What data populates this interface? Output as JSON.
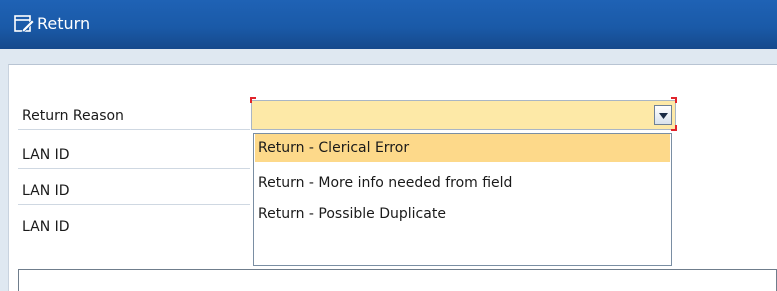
{
  "window": {
    "title": "Return",
    "title_icon": "edit-window-icon"
  },
  "form": {
    "fields": [
      {
        "label": "Return Reason"
      },
      {
        "label": "LAN ID"
      },
      {
        "label": "LAN ID"
      },
      {
        "label": "LAN ID"
      }
    ],
    "return_reason": {
      "value": "",
      "options": [
        "Return - Clerical Error",
        "Return - More info needed from field",
        "Return - Possible Duplicate"
      ],
      "highlighted_option": "Return - Clerical Error"
    }
  },
  "colors": {
    "titlebar": "#1a5aa8",
    "field_highlight": "#fde9a7",
    "option_highlight": "#fdd98a",
    "required_marker": "#e0242c"
  },
  "icons": {
    "dropdown_toggle": "chevron-down-icon"
  }
}
